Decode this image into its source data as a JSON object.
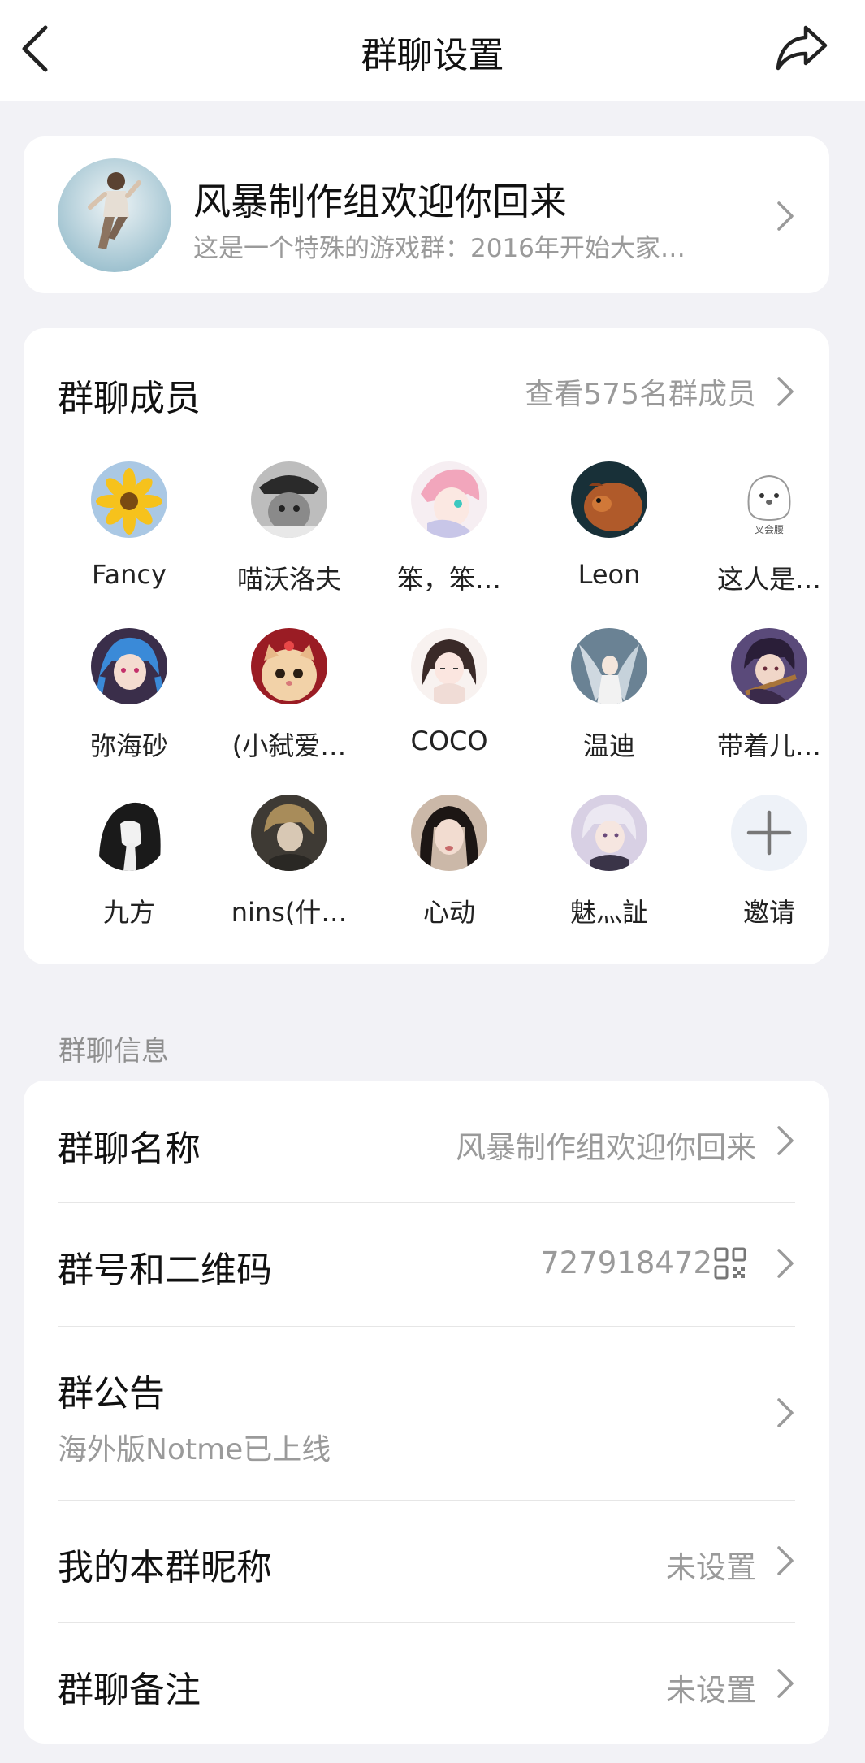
{
  "header": {
    "title": "群聊设置",
    "back_icon": "chevron-left-icon",
    "share_icon": "share-arrow-icon"
  },
  "group": {
    "name": "风暴制作组欢迎你回来",
    "description": "这是一个特殊的游戏群：2016年开始大家…"
  },
  "members": {
    "title": "群聊成员",
    "view_all": "查看575名群成员",
    "list": [
      {
        "name": "Fancy",
        "avatar": "sunflower"
      },
      {
        "name": "喵沃洛夫",
        "avatar": "cat-in-hat"
      },
      {
        "name": "笨，笨…",
        "avatar": "anime-pink-hair"
      },
      {
        "name": "Leon",
        "avatar": "guinea-pig"
      },
      {
        "name": "这人是…",
        "avatar": "white-doodle"
      },
      {
        "name": "弥海砂",
        "avatar": "anime-blue-braids"
      },
      {
        "name": "(小弑爱…",
        "avatar": "cat-photo"
      },
      {
        "name": "COCO",
        "avatar": "anime-girl-sketch"
      },
      {
        "name": "温迪",
        "avatar": "angel-white"
      },
      {
        "name": "带着儿…",
        "avatar": "anime-boy-guitar"
      },
      {
        "name": "九方",
        "avatar": "hooded-figure"
      },
      {
        "name": "nins(什…",
        "avatar": "dark-portrait"
      },
      {
        "name": "心动",
        "avatar": "girl-photo"
      },
      {
        "name": "魅灬訨",
        "avatar": "anime-white-hair"
      },
      {
        "name": "邀请",
        "avatar": "plus-icon"
      }
    ]
  },
  "info": {
    "section_label": "群聊信息",
    "rows": {
      "name": {
        "label": "群聊名称",
        "value": "风暴制作组欢迎你回来"
      },
      "number": {
        "label": "群号和二维码",
        "value": "727918472"
      },
      "notice": {
        "label": "群公告",
        "sub": "海外版Notme已上线"
      },
      "nickname": {
        "label": "我的本群昵称",
        "value": "未设置"
      },
      "remark": {
        "label": "群聊备注",
        "value": "未设置"
      }
    }
  }
}
